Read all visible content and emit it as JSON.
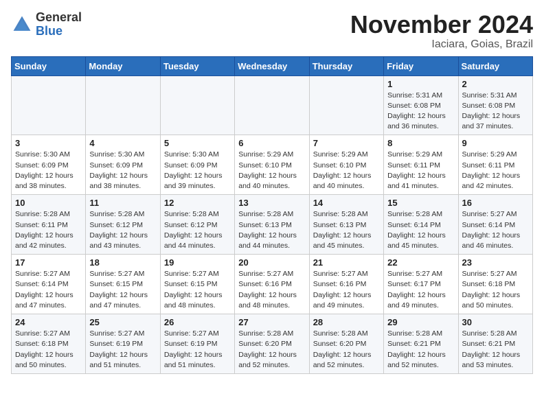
{
  "header": {
    "logo_line1": "General",
    "logo_line2": "Blue",
    "month": "November 2024",
    "location": "Iaciara, Goias, Brazil"
  },
  "weekdays": [
    "Sunday",
    "Monday",
    "Tuesday",
    "Wednesday",
    "Thursday",
    "Friday",
    "Saturday"
  ],
  "weeks": [
    [
      {
        "day": "",
        "info": ""
      },
      {
        "day": "",
        "info": ""
      },
      {
        "day": "",
        "info": ""
      },
      {
        "day": "",
        "info": ""
      },
      {
        "day": "",
        "info": ""
      },
      {
        "day": "1",
        "info": "Sunrise: 5:31 AM\nSunset: 6:08 PM\nDaylight: 12 hours and 36 minutes."
      },
      {
        "day": "2",
        "info": "Sunrise: 5:31 AM\nSunset: 6:08 PM\nDaylight: 12 hours and 37 minutes."
      }
    ],
    [
      {
        "day": "3",
        "info": "Sunrise: 5:30 AM\nSunset: 6:09 PM\nDaylight: 12 hours and 38 minutes."
      },
      {
        "day": "4",
        "info": "Sunrise: 5:30 AM\nSunset: 6:09 PM\nDaylight: 12 hours and 38 minutes."
      },
      {
        "day": "5",
        "info": "Sunrise: 5:30 AM\nSunset: 6:09 PM\nDaylight: 12 hours and 39 minutes."
      },
      {
        "day": "6",
        "info": "Sunrise: 5:29 AM\nSunset: 6:10 PM\nDaylight: 12 hours and 40 minutes."
      },
      {
        "day": "7",
        "info": "Sunrise: 5:29 AM\nSunset: 6:10 PM\nDaylight: 12 hours and 40 minutes."
      },
      {
        "day": "8",
        "info": "Sunrise: 5:29 AM\nSunset: 6:11 PM\nDaylight: 12 hours and 41 minutes."
      },
      {
        "day": "9",
        "info": "Sunrise: 5:29 AM\nSunset: 6:11 PM\nDaylight: 12 hours and 42 minutes."
      }
    ],
    [
      {
        "day": "10",
        "info": "Sunrise: 5:28 AM\nSunset: 6:11 PM\nDaylight: 12 hours and 42 minutes."
      },
      {
        "day": "11",
        "info": "Sunrise: 5:28 AM\nSunset: 6:12 PM\nDaylight: 12 hours and 43 minutes."
      },
      {
        "day": "12",
        "info": "Sunrise: 5:28 AM\nSunset: 6:12 PM\nDaylight: 12 hours and 44 minutes."
      },
      {
        "day": "13",
        "info": "Sunrise: 5:28 AM\nSunset: 6:13 PM\nDaylight: 12 hours and 44 minutes."
      },
      {
        "day": "14",
        "info": "Sunrise: 5:28 AM\nSunset: 6:13 PM\nDaylight: 12 hours and 45 minutes."
      },
      {
        "day": "15",
        "info": "Sunrise: 5:28 AM\nSunset: 6:14 PM\nDaylight: 12 hours and 45 minutes."
      },
      {
        "day": "16",
        "info": "Sunrise: 5:27 AM\nSunset: 6:14 PM\nDaylight: 12 hours and 46 minutes."
      }
    ],
    [
      {
        "day": "17",
        "info": "Sunrise: 5:27 AM\nSunset: 6:14 PM\nDaylight: 12 hours and 47 minutes."
      },
      {
        "day": "18",
        "info": "Sunrise: 5:27 AM\nSunset: 6:15 PM\nDaylight: 12 hours and 47 minutes."
      },
      {
        "day": "19",
        "info": "Sunrise: 5:27 AM\nSunset: 6:15 PM\nDaylight: 12 hours and 48 minutes."
      },
      {
        "day": "20",
        "info": "Sunrise: 5:27 AM\nSunset: 6:16 PM\nDaylight: 12 hours and 48 minutes."
      },
      {
        "day": "21",
        "info": "Sunrise: 5:27 AM\nSunset: 6:16 PM\nDaylight: 12 hours and 49 minutes."
      },
      {
        "day": "22",
        "info": "Sunrise: 5:27 AM\nSunset: 6:17 PM\nDaylight: 12 hours and 49 minutes."
      },
      {
        "day": "23",
        "info": "Sunrise: 5:27 AM\nSunset: 6:18 PM\nDaylight: 12 hours and 50 minutes."
      }
    ],
    [
      {
        "day": "24",
        "info": "Sunrise: 5:27 AM\nSunset: 6:18 PM\nDaylight: 12 hours and 50 minutes."
      },
      {
        "day": "25",
        "info": "Sunrise: 5:27 AM\nSunset: 6:19 PM\nDaylight: 12 hours and 51 minutes."
      },
      {
        "day": "26",
        "info": "Sunrise: 5:27 AM\nSunset: 6:19 PM\nDaylight: 12 hours and 51 minutes."
      },
      {
        "day": "27",
        "info": "Sunrise: 5:28 AM\nSunset: 6:20 PM\nDaylight: 12 hours and 52 minutes."
      },
      {
        "day": "28",
        "info": "Sunrise: 5:28 AM\nSunset: 6:20 PM\nDaylight: 12 hours and 52 minutes."
      },
      {
        "day": "29",
        "info": "Sunrise: 5:28 AM\nSunset: 6:21 PM\nDaylight: 12 hours and 52 minutes."
      },
      {
        "day": "30",
        "info": "Sunrise: 5:28 AM\nSunset: 6:21 PM\nDaylight: 12 hours and 53 minutes."
      }
    ]
  ]
}
